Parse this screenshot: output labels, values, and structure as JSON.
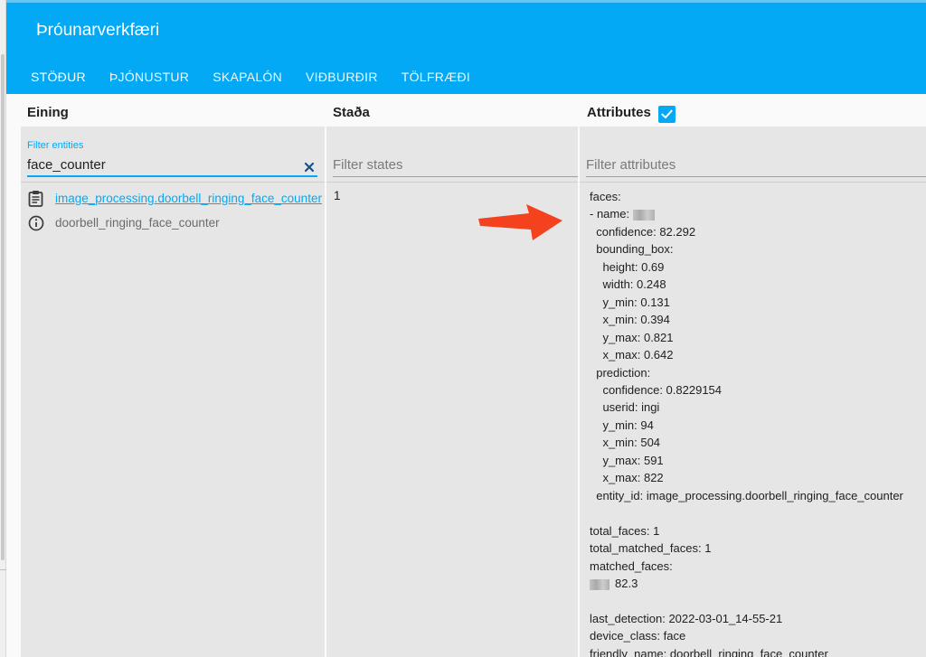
{
  "header": {
    "title": "Þróunarverkfæri",
    "tabs": [
      {
        "label": "STÖÐUR",
        "active": true
      },
      {
        "label": "ÞJÓNUSTUR",
        "active": false
      },
      {
        "label": "SKAPALÓN",
        "active": false
      },
      {
        "label": "VIÐBURÐIR",
        "active": false
      },
      {
        "label": "TÖLFRÆÐI",
        "active": false
      }
    ]
  },
  "columns": {
    "entity": "Eining",
    "state": "Staða",
    "attributes": "Attributes",
    "attributes_checked": true
  },
  "filters": {
    "entity_label": "Filter entities",
    "entity_value": "face_counter",
    "state_placeholder": "Filter states",
    "attributes_placeholder": "Filter attributes"
  },
  "entity": {
    "id": "image_processing.doorbell_ringing_face_counter",
    "name": "doorbell_ringing_face_counter",
    "state": "1"
  },
  "attributes": [
    "faces:",
    "- name: [blur]",
    "  confidence: 82.292",
    "  bounding_box:",
    "    height: 0.69",
    "    width: 0.248",
    "    y_min: 0.131",
    "    x_min: 0.394",
    "    y_max: 0.821",
    "    x_max: 0.642",
    "  prediction:",
    "    confidence: 0.8229154",
    "    userid: ingi",
    "    y_min: 94",
    "    x_min: 504",
    "    y_max: 591",
    "    x_max: 822",
    "  entity_id: image_processing.doorbell_ringing_face_counter",
    "",
    "total_faces: 1",
    "total_matched_faces: 1",
    "matched_faces:",
    "[blur]82.3",
    "",
    "last_detection: 2022-03-01_14-55-21",
    "device_class: face",
    "friendly_name: doorbell_ringing_face_counter"
  ],
  "colors": {
    "primary": "#03a9f4",
    "annotation_arrow": "#f4411e"
  },
  "icons": {
    "entity_icon": "clipboard-text-icon",
    "info_icon": "information-outline-icon",
    "clear_icon": "close-icon",
    "checkbox_icon": "checkbox-checked-icon"
  }
}
